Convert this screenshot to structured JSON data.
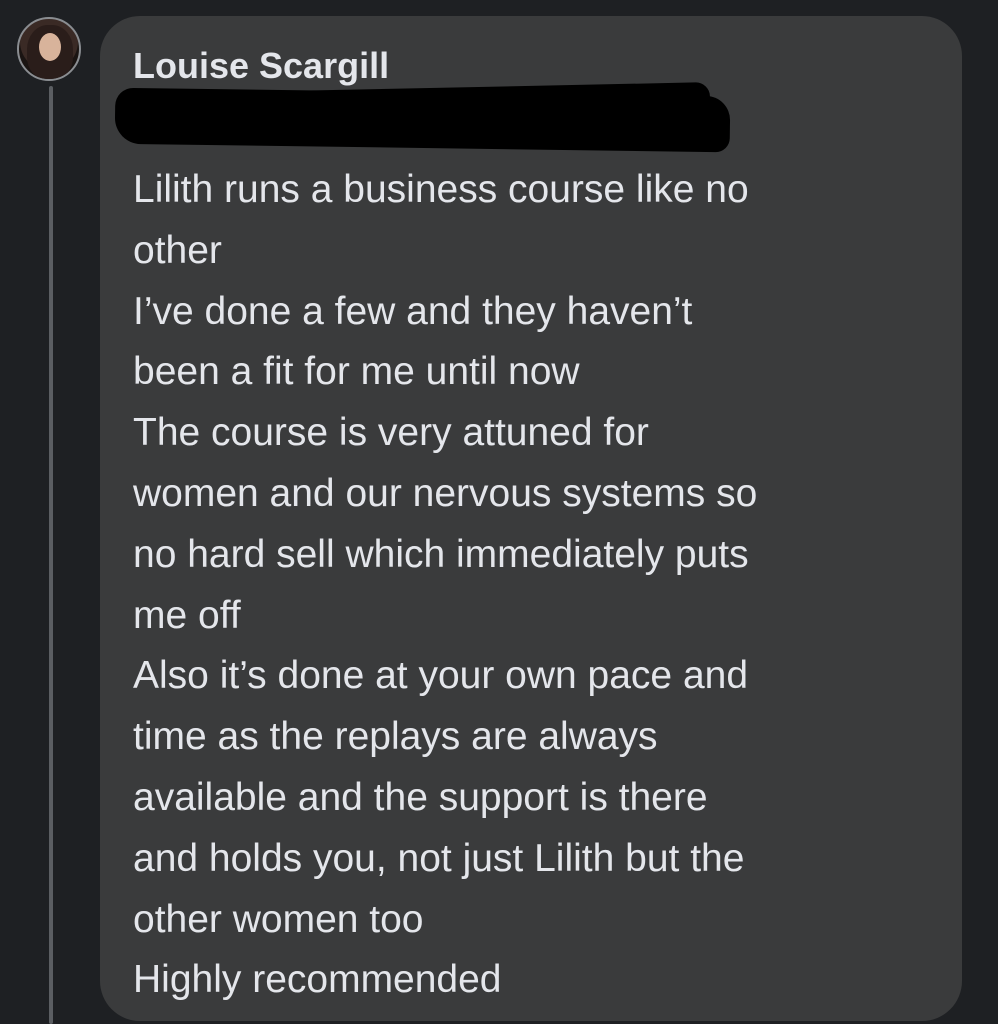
{
  "comment": {
    "author": "Louise Scargill",
    "lines": [
      "Lilith runs a business course like no",
      "other",
      "I’ve done a few and they haven’t",
      "been a fit for me until now",
      "The course is very attuned for",
      "women and our nervous systems so",
      "no hard sell which immediately puts",
      "me off",
      "Also it’s done at your own pace and",
      "time as the replays are always",
      "available and the support is there",
      "and holds you, not just Lilith but the",
      "other women too",
      "Highly recommended"
    ]
  }
}
